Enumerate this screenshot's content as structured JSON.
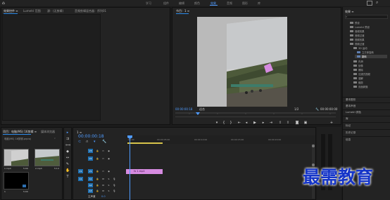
{
  "workspaces": [
    "学习",
    "组件",
    "编辑",
    "颜色",
    "效果",
    "音频",
    "图形",
    "库"
  ],
  "active_workspace": "效果",
  "source_panel": {
    "tabs": [
      "效果控件 ≡",
      "Lumetri 范围",
      "源：(无剪辑)",
      "音频剪辑混合器：序列01"
    ],
    "subheader": "(未选择剪辑)"
  },
  "program": {
    "tab": "节目：1 ≡",
    "current_time": "00:00:00:18",
    "fit": "适合",
    "quality": "1/2",
    "end_time": "00:00:00:00"
  },
  "timeline": {
    "tab": "1 ≡",
    "timecode": "00:00:00:18",
    "ruler_ticks": [
      ":00:00",
      "00:00:05:00",
      "00:00:10:00",
      "00:00:15:00",
      "00:00:20:00"
    ],
    "clip_label": "fx 1.mp4",
    "video_tracks": [
      "V3",
      "V2",
      "V1"
    ],
    "audio_tracks": [
      "A1",
      "A2",
      "A3"
    ],
    "master_label": "主声道",
    "master_value": "0.0"
  },
  "project": {
    "tabs": [
      "项目：电脑(MS) 16剪辑 ≡",
      "媒体浏览器"
    ],
    "path": "电脑(MS) 16剪辑.prproj",
    "items": [
      {
        "name": "1.mp4",
        "duration": "5:00"
      },
      {
        "name": "2.mp4",
        "duration": "5:14"
      },
      {
        "name": "1",
        "duration": "5:00"
      }
    ]
  },
  "effects_panel": {
    "title": "效果 ≡",
    "search_placeholder": "",
    "tree": [
      "预设",
      "Lumetri 预设",
      "音频效果",
      "音频过渡",
      "视频效果",
      "视频过渡",
      "3D 运动",
      "立方体旋转",
      "翻转",
      "内滑",
      "划像",
      "擦除",
      "沉浸式视频",
      "溶解",
      "缩放",
      "页面剥落"
    ],
    "sections": [
      "基本图形",
      "基本声音",
      "Lumetri 颜色",
      "库",
      "标记",
      "历史记录",
      "信息"
    ]
  },
  "watermark": "最需教育",
  "colors": {
    "accent": "#4f9bff",
    "clip": "#d68be0",
    "watermark": "#1535c8"
  }
}
